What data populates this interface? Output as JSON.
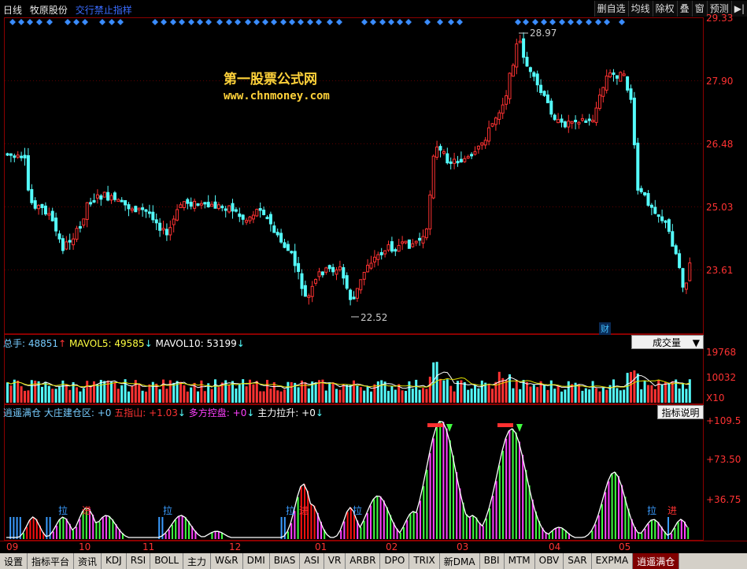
{
  "header": {
    "period": "日线",
    "stock_name": "牧原股份",
    "notice": "交行禁止指样"
  },
  "toolbar": {
    "buttons": [
      "删自选",
      "均线",
      "除权",
      "叠",
      "窗",
      "预测",
      "▶|"
    ]
  },
  "price_axis": [
    "29.33",
    "27.90",
    "26.48",
    "25.03",
    "23.61"
  ],
  "annotations": {
    "high": "28.97",
    "low": "22.52",
    "fin_badge": "财"
  },
  "watermark": {
    "line1": "第一股票公式网",
    "line2": "www.chnmoney.com"
  },
  "volume_panel": {
    "label_total": "总手:",
    "total": "48851",
    "total_arrow": "↑",
    "label_ma5": "MAVOL5:",
    "ma5": "49585",
    "ma5_arrow": "↓",
    "label_ma10": "MAVOL10:",
    "ma10": "53199",
    "ma10_arrow": "↓",
    "selector": "成交量",
    "axis": [
      "19768",
      "10032"
    ],
    "multiplier": "X10"
  },
  "indicator_panel": {
    "name": "逍遥满仓",
    "label1": "大庄建仓区:",
    "value1": "+0",
    "label2": "五指山:",
    "value2": "+1.03",
    "arrow2": "↓",
    "label3": "多方控盘:",
    "value3": "+0",
    "arrow3": "↓",
    "label4": "主力拉升:",
    "value4": "+0",
    "arrow4": "↓",
    "button": "指标说明",
    "axis": [
      "+109.5",
      "+73.50",
      "+36.75"
    ],
    "marks": [
      "拉",
      "进",
      "拉",
      "拉",
      "进",
      "拉",
      "拉",
      "进"
    ]
  },
  "date_axis": [
    "09",
    "10",
    "11",
    "12",
    "01",
    "02",
    "03",
    "04",
    "05"
  ],
  "tabs": [
    "设置",
    "指标平台",
    "资讯",
    "KDJ",
    "RSI",
    "BOLL",
    "主力",
    "W&R",
    "DMI",
    "BIAS",
    "ASI",
    "VR",
    "ARBR",
    "DPO",
    "TRIX",
    "新DMA",
    "BBI",
    "MTM",
    "OBV",
    "SAR",
    "EXPMA",
    "逍遥满仓"
  ],
  "active_tab": "逍遥满仓",
  "colors": {
    "up": "#ff3232",
    "down": "#54fcfc",
    "grid": "#8b0000",
    "axis_text": "#ff3232",
    "accent": "#3a6cff"
  }
}
